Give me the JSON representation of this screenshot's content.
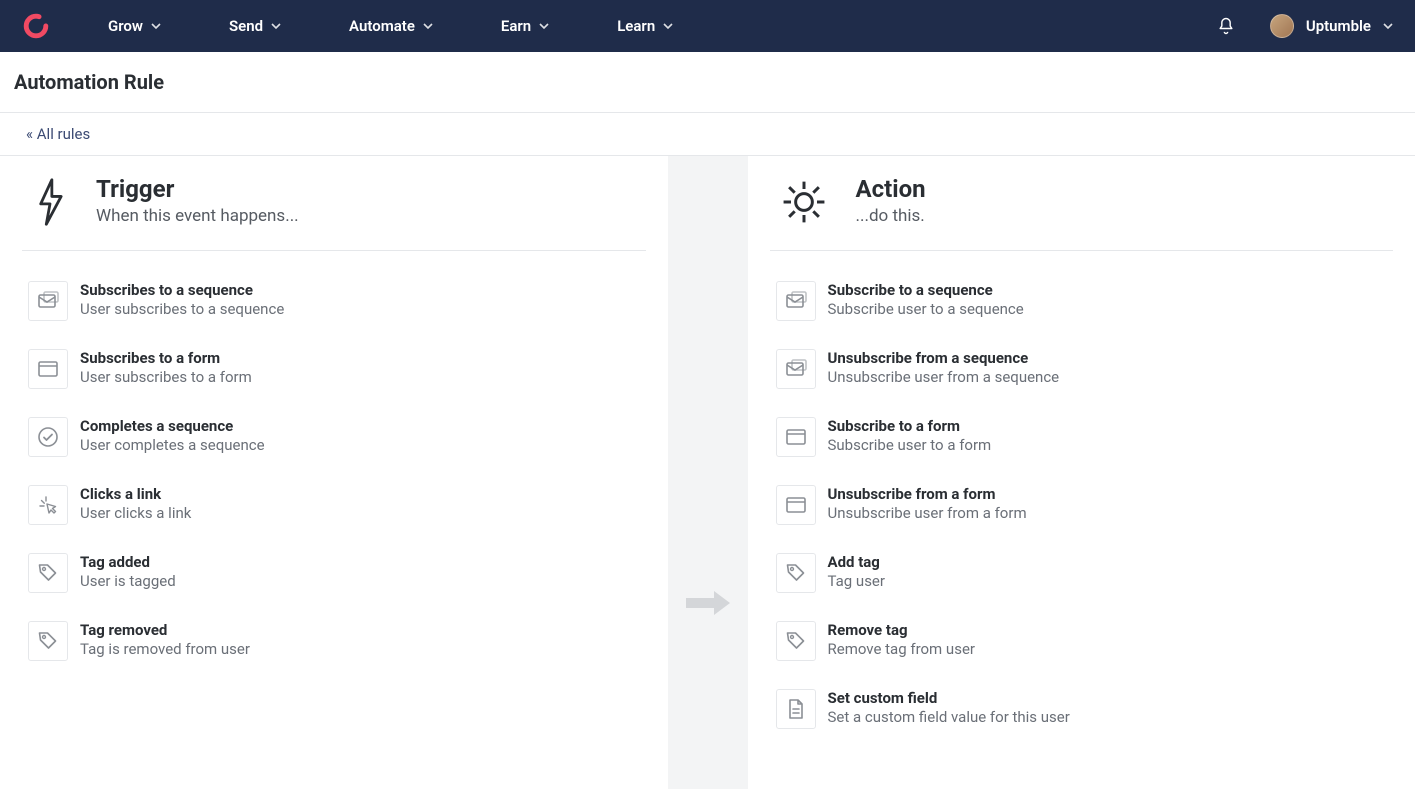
{
  "nav": {
    "items": [
      "Grow",
      "Send",
      "Automate",
      "Earn",
      "Learn"
    ],
    "account": "Uptumble"
  },
  "page": {
    "title": "Automation Rule",
    "breadcrumb": "« All rules"
  },
  "trigger": {
    "title": "Trigger",
    "subtitle": "When this event happens...",
    "options": [
      {
        "icon": "sequence",
        "title": "Subscribes to a sequence",
        "sub": "User subscribes to a sequence"
      },
      {
        "icon": "form",
        "title": "Subscribes to a form",
        "sub": "User subscribes to a form"
      },
      {
        "icon": "check",
        "title": "Completes a sequence",
        "sub": "User completes a sequence"
      },
      {
        "icon": "click",
        "title": "Clicks a link",
        "sub": "User clicks a link"
      },
      {
        "icon": "tag",
        "title": "Tag added",
        "sub": "User is tagged"
      },
      {
        "icon": "tag",
        "title": "Tag removed",
        "sub": "Tag is removed from user"
      }
    ]
  },
  "action": {
    "title": "Action",
    "subtitle": "...do this.",
    "options": [
      {
        "icon": "sequence",
        "title": "Subscribe to a sequence",
        "sub": "Subscribe user to a sequence"
      },
      {
        "icon": "sequence",
        "title": "Unsubscribe from a sequence",
        "sub": "Unsubscribe user from a sequence"
      },
      {
        "icon": "form",
        "title": "Subscribe to a form",
        "sub": "Subscribe user to a form"
      },
      {
        "icon": "form",
        "title": "Unsubscribe from a form",
        "sub": "Unsubscribe user from a form"
      },
      {
        "icon": "tag",
        "title": "Add tag",
        "sub": "Tag user"
      },
      {
        "icon": "tag",
        "title": "Remove tag",
        "sub": "Remove tag from user"
      },
      {
        "icon": "doc",
        "title": "Set custom field",
        "sub": "Set a custom field value for this user"
      }
    ]
  }
}
